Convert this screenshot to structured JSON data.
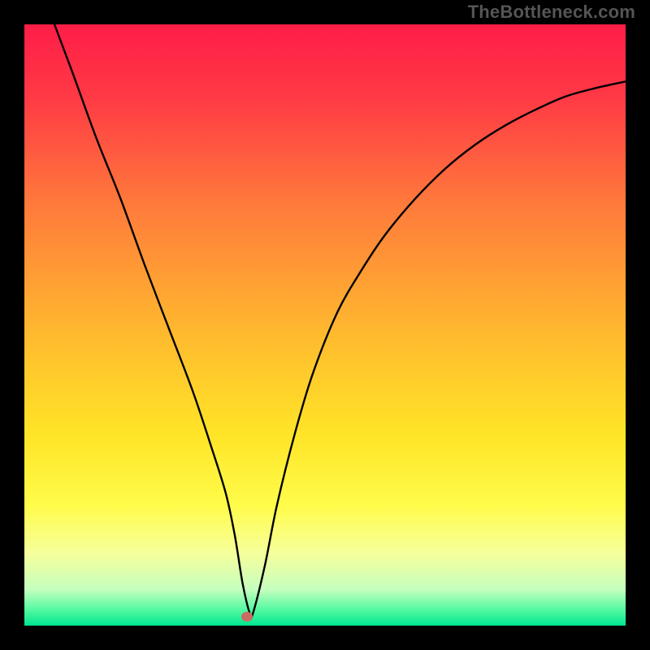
{
  "watermark": "TheBottleneck.com",
  "chart_data": {
    "type": "line",
    "title": "",
    "xlabel": "",
    "ylabel": "",
    "xlim": [
      0,
      100
    ],
    "ylim": [
      0,
      100
    ],
    "background_gradient": {
      "orientation": "vertical",
      "stops": [
        {
          "offset": 0.0,
          "color": "#ff1d48"
        },
        {
          "offset": 0.12,
          "color": "#ff3945"
        },
        {
          "offset": 0.3,
          "color": "#ff7a3b"
        },
        {
          "offset": 0.52,
          "color": "#ffbb2e"
        },
        {
          "offset": 0.68,
          "color": "#ffe427"
        },
        {
          "offset": 0.8,
          "color": "#fffc4a"
        },
        {
          "offset": 0.88,
          "color": "#f6ff9c"
        },
        {
          "offset": 0.94,
          "color": "#c5ffbe"
        },
        {
          "offset": 0.975,
          "color": "#4ff8a0"
        },
        {
          "offset": 1.0,
          "color": "#00e590"
        }
      ]
    },
    "series": [
      {
        "name": "bottleneck-curve",
        "color": "#000000",
        "x": [
          5,
          8,
          12,
          16,
          20,
          24,
          28,
          31,
          33.5,
          35,
          36.3,
          37.5,
          38,
          40,
          42,
          45,
          48,
          52,
          56,
          60,
          65,
          70,
          75,
          80,
          85,
          90,
          95,
          100
        ],
        "y": [
          100,
          92,
          81,
          71,
          60,
          49.5,
          39,
          30,
          22,
          15,
          7,
          2,
          2,
          10,
          20,
          32,
          42,
          52,
          59,
          65,
          71,
          76,
          80,
          83.2,
          85.8,
          88,
          89.4,
          90.5
        ]
      }
    ],
    "marker": {
      "x": 37,
      "y": 1.5,
      "color": "#c96c64"
    },
    "frame": {
      "border_color": "#000000",
      "border_width": 30
    }
  }
}
